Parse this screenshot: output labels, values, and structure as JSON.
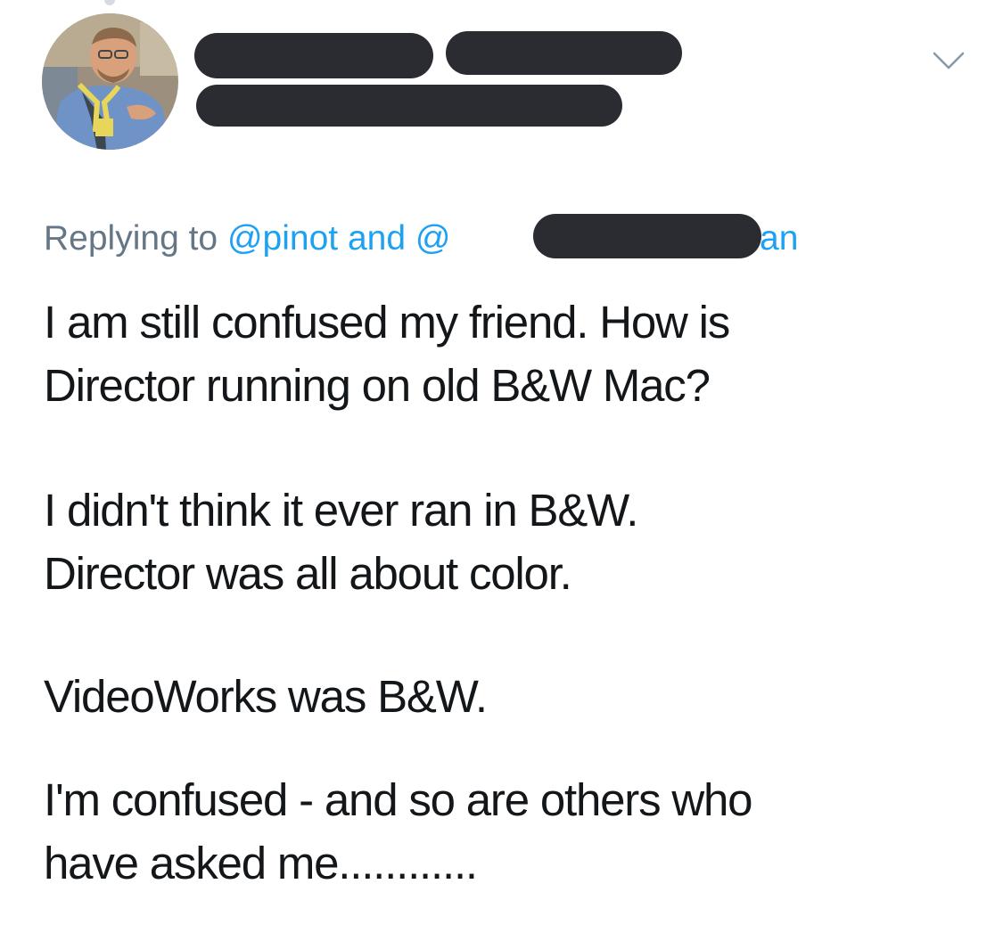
{
  "reply": {
    "prefix": "Replying to",
    "mention_1": "@pinot",
    "connector": "and",
    "mention_2_start": "@",
    "mention_2_end": "an"
  },
  "body": {
    "paragraph_1": "I am still confused my friend.  How is\nDirector running on old B&W Mac?",
    "paragraph_2": "I didn't think it ever ran in B&W.\nDirector was all about color.",
    "paragraph_3": "VideoWorks was B&W.",
    "paragraph_4": "I'm confused - and so are others who\nhave asked me............"
  },
  "icons": {
    "more": "chevron-down-icon"
  },
  "colors": {
    "link": "#1da1f2",
    "secondary_text": "#657786",
    "primary_text": "#14171a",
    "redaction": "#2a2c31"
  }
}
